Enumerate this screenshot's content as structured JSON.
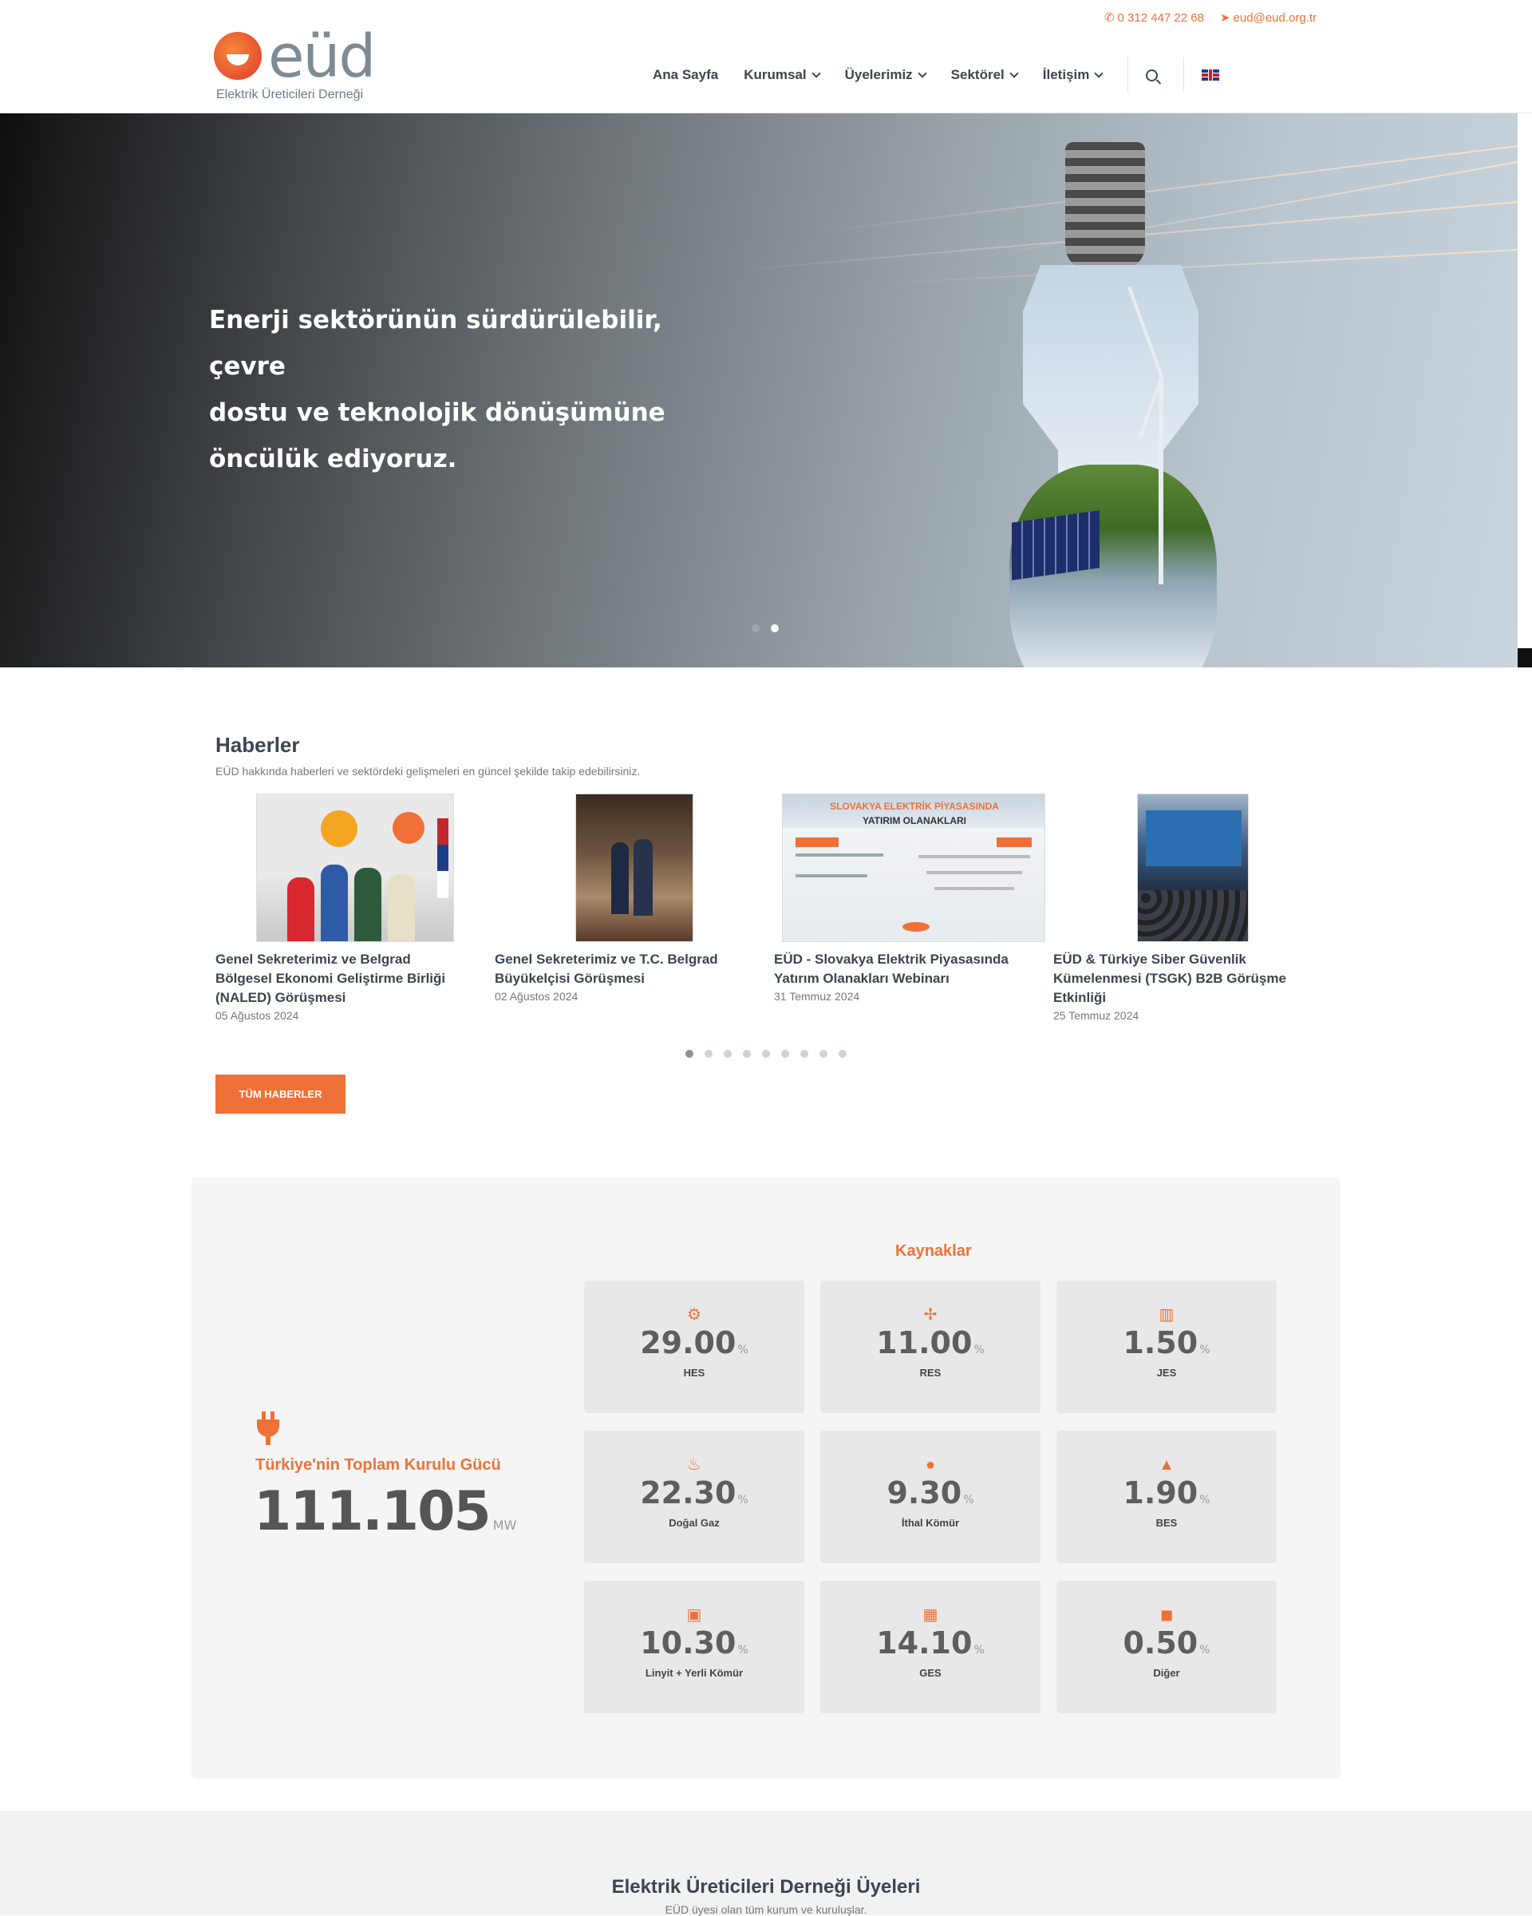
{
  "header": {
    "phone": "0 312 447 22 68",
    "email": "eud@eud.org.tr",
    "logo_word": "eüd",
    "logo_sub": "Elektrik Üreticileri Derneği",
    "nav": [
      {
        "label": "Ana Sayfa",
        "has_menu": false
      },
      {
        "label": "Kurumsal",
        "has_menu": true
      },
      {
        "label": "Üyelerimiz",
        "has_menu": true
      },
      {
        "label": "Sektörel",
        "has_menu": true
      },
      {
        "label": "İletişim",
        "has_menu": true
      }
    ],
    "language_icon": "uk-flag-icon",
    "accent_color": "#f07138"
  },
  "hero": {
    "headline_1": "Enerji sektörünün sürdürülebilir, çevre",
    "headline_2": "dostu ve teknolojik dönüşümüne",
    "headline_3": "öncülük ediyoruz.",
    "slides": 2,
    "active_slide": 2
  },
  "news": {
    "title": "Haberler",
    "subtitle": "EÜD hakkında haberleri ve sektördeki gelişmeleri en güncel şekilde takip edebilirsiniz.",
    "items": [
      {
        "title": "Genel Sekreterimiz ve Belgrad Bölgesel Ekonomi Geliştirme Birliği (NALED) Görüşmesi",
        "date": "05 Ağustos 2024"
      },
      {
        "title": "Genel Sekreterimiz ve T.C. Belgrad Büyükelçisi Görüşmesi",
        "date": "02 Ağustos 2024"
      },
      {
        "title": "EÜD - Slovakya Elektrik Piyasasında Yatırım Olanakları Webinarı",
        "date": "31 Temmuz 2024"
      },
      {
        "title": "EÜD & Türkiye Siber Güvenlik Kümelenmesi (TSGK) B2B Görüşme Etkinliği",
        "date": "25 Temmuz 2024"
      }
    ],
    "webinar_heading_1": "SLOVAKYA ELEKTRİK PİYASASINDA",
    "webinar_heading_2": "YATIRIM OLANAKLARI",
    "pages": 9,
    "active_page": 1,
    "all_button": "TÜM HABERLER"
  },
  "stats": {
    "total_label": "Türkiye'nin Toplam Kurulu Gücü",
    "total_value": "111.105",
    "total_unit": "MW",
    "sources_title": "Kaynaklar",
    "sources": [
      {
        "value": "29.00",
        "unit": "%",
        "name": "HES",
        "icon": "gear-icon"
      },
      {
        "value": "11.00",
        "unit": "%",
        "name": "RES",
        "icon": "wind-icon"
      },
      {
        "value": "1.50",
        "unit": "%",
        "name": "JES",
        "icon": "geothermal-icon"
      },
      {
        "value": "22.30",
        "unit": "%",
        "name": "Doğal Gaz",
        "icon": "flame-icon"
      },
      {
        "value": "9.30",
        "unit": "%",
        "name": "İthal Kömür",
        "icon": "coal-icon"
      },
      {
        "value": "1.90",
        "unit": "%",
        "name": "BES",
        "icon": "biomass-icon"
      },
      {
        "value": "10.30",
        "unit": "%",
        "name": "Linyit + Yerli Kömür",
        "icon": "lignite-icon"
      },
      {
        "value": "14.10",
        "unit": "%",
        "name": "GES",
        "icon": "solar-panel-icon"
      },
      {
        "value": "0.50",
        "unit": "%",
        "name": "Diğer",
        "icon": "other-icon"
      }
    ]
  },
  "members": {
    "title": "Elektrik Üreticileri Derneği Üyeleri",
    "subtitle": "EÜD üyesi olan tüm kurum ve kuruluşlar."
  }
}
